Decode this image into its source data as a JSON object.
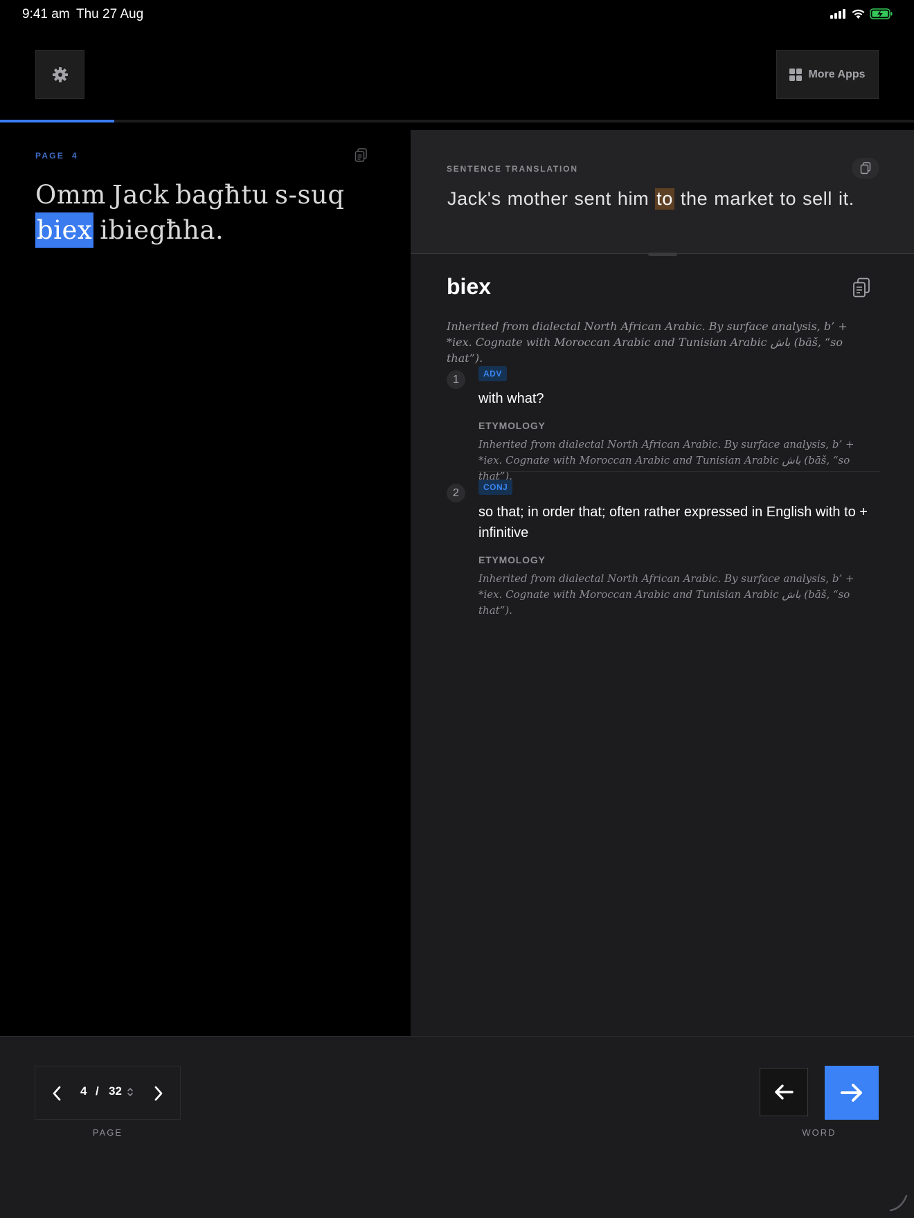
{
  "status_bar": {
    "time": "9:41 am",
    "date": "Thu 27 Aug",
    "icons": [
      "signal-icon",
      "wifi-icon",
      "battery-charging-icon"
    ],
    "battery_color": "#34c759"
  },
  "toolbar": {
    "settings_icon": "gear-icon",
    "more_apps_label": "More Apps",
    "more_apps_icon": "grid-icon"
  },
  "progress": {
    "fraction": 0.125,
    "color": "#3a7cf0"
  },
  "source": {
    "page_label": "PAGE",
    "page_number": "4",
    "words": [
      "Omm",
      "Jack",
      "bagħtu",
      "s-suq",
      "biex",
      "ibiegħha."
    ],
    "highlighted_index": 4,
    "highlight_color": "#3a7cf0"
  },
  "translation": {
    "label": "SENTENCE TRANSLATION",
    "words": [
      "Jack's",
      "mother",
      "sent",
      "him",
      "to",
      "the",
      "market",
      "to",
      "sell",
      "it."
    ],
    "highlighted_index": 4,
    "highlight_color": "#5e4024"
  },
  "dictionary": {
    "headword": "biex",
    "etymology": "Inherited from dialectal North African Arabic. By surface analysis, b’ + *iex. Cognate with Moroccan Arabic and Tunisian Arabic باش (bāš, “so that”).",
    "senses": [
      {
        "number": "1",
        "pos": "ADV",
        "definition": "with what?",
        "etymology_heading": "ETYMOLOGY",
        "etymology": "Inherited from dialectal North African Arabic. By surface analysis, b’ + *iex. Cognate with Moroccan Arabic and Tunisian Arabic باش (bāš, “so that”)."
      },
      {
        "number": "2",
        "pos": "CONJ",
        "definition": "so that; in order that; often rather expressed in English with to + infinitive",
        "etymology_heading": "ETYMOLOGY",
        "etymology": "Inherited from dialectal North African Arabic. By surface analysis, b’ + *iex. Cognate with Moroccan Arabic and Tunisian Arabic باش (bāš, “so that”)."
      }
    ]
  },
  "bottom_nav": {
    "page_current": "4",
    "page_separator": "/",
    "page_total": "32",
    "page_caption": "PAGE",
    "word_caption": "WORD",
    "accent_color": "#3b82f6"
  }
}
